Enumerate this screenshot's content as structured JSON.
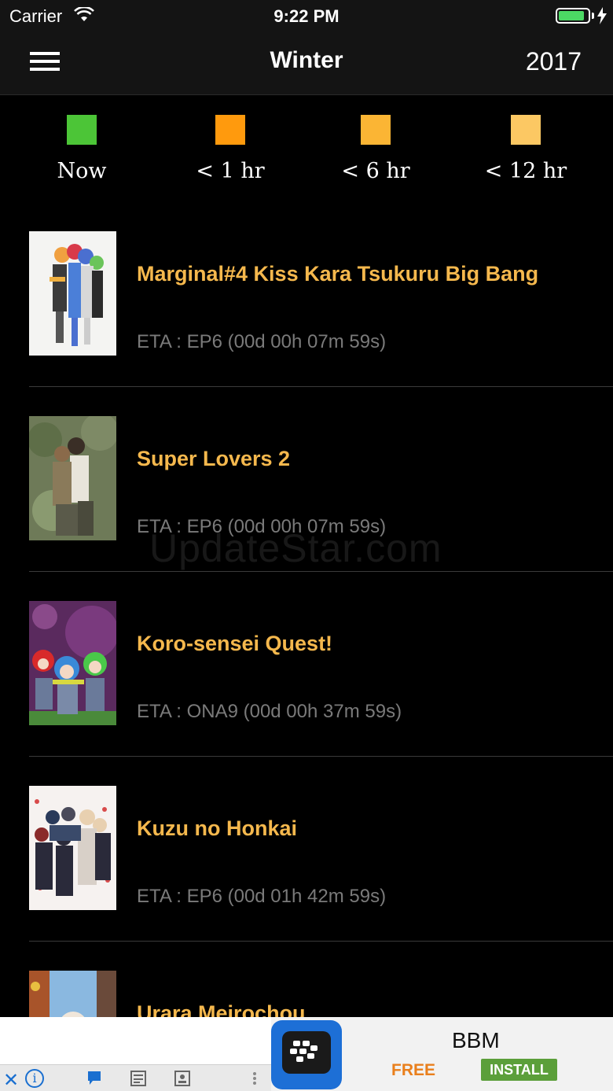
{
  "status_bar": {
    "carrier": "Carrier",
    "time": "9:22 PM",
    "battery_level": 0.9
  },
  "nav": {
    "title": "Winter",
    "year": "2017"
  },
  "legend": [
    {
      "label": "Now",
      "color": "#4cc537"
    },
    {
      "label": "< 1 hr",
      "color": "#ff9a0d"
    },
    {
      "label": "< 6 hr",
      "color": "#fbb534"
    },
    {
      "label": "< 12 hr",
      "color": "#fcc863"
    }
  ],
  "shows": [
    {
      "title": "Marginal#4 Kiss Kara Tsukuru Big Bang",
      "eta": "ETA : EP6 (00d 00h 07m 59s)"
    },
    {
      "title": "Super Lovers 2",
      "eta": "ETA : EP6 (00d 00h 07m 59s)"
    },
    {
      "title": "Koro-sensei Quest!",
      "eta": "ETA : ONA9 (00d 00h 37m 59s)"
    },
    {
      "title": "Kuzu no Honkai",
      "eta": "ETA : EP6 (00d 01h 42m 59s)"
    },
    {
      "title": "Urara Meirochou",
      "eta": ""
    }
  ],
  "watermark": "UpdateStar.com",
  "ad": {
    "app_name": "BBM",
    "price": "FREE",
    "install_label": "INSTALL",
    "close_glyph": "✕",
    "info_glyph": "i"
  }
}
